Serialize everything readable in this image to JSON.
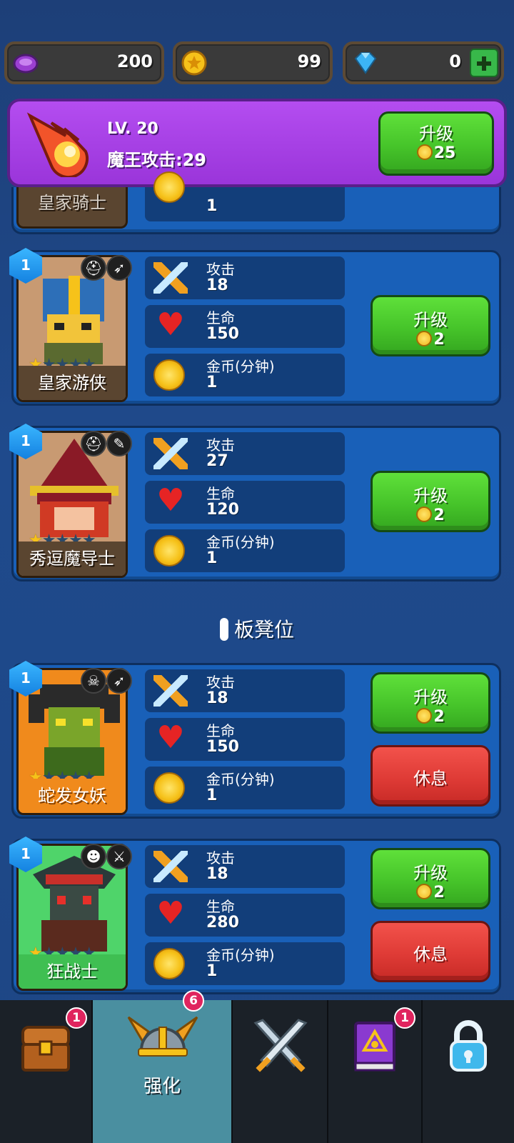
{
  "currency": {
    "gems_purple": "200",
    "coins": "99",
    "diamonds": "0"
  },
  "boss": {
    "level": "LV. 20",
    "attack": "魔王攻击:29",
    "upgrade_label": "升级",
    "upgrade_cost": "25"
  },
  "partial_card": {
    "name": "皇家骑士",
    "value": "1"
  },
  "stat_labels": {
    "attack": "攻击",
    "hp": "生命",
    "gold": "金币(分钟)"
  },
  "active_heroes": [
    {
      "name": "皇家游侠",
      "level": "1",
      "stars": 1,
      "attack": "18",
      "hp": "150",
      "gold": "1",
      "upgrade_label": "升级",
      "upgrade_cost": "2"
    },
    {
      "name": "秀逗魔导士",
      "level": "1",
      "stars": 1,
      "attack": "27",
      "hp": "120",
      "gold": "1",
      "upgrade_label": "升级",
      "upgrade_cost": "2"
    }
  ],
  "bench_title": "板凳位",
  "bench_heroes": [
    {
      "name": "蛇发女妖",
      "level": "1",
      "stars": 1,
      "attack": "18",
      "hp": "150",
      "gold": "1",
      "upgrade_label": "升级",
      "upgrade_cost": "2",
      "rest_label": "休息"
    },
    {
      "name": "狂战士",
      "level": "1",
      "stars": 1,
      "attack": "18",
      "hp": "280",
      "gold": "1",
      "upgrade_label": "升级",
      "upgrade_cost": "2",
      "rest_label": "休息"
    }
  ],
  "nav": {
    "treasure_badge": "1",
    "enhance_label": "强化",
    "enhance_badge": "6",
    "book_badge": "1"
  }
}
